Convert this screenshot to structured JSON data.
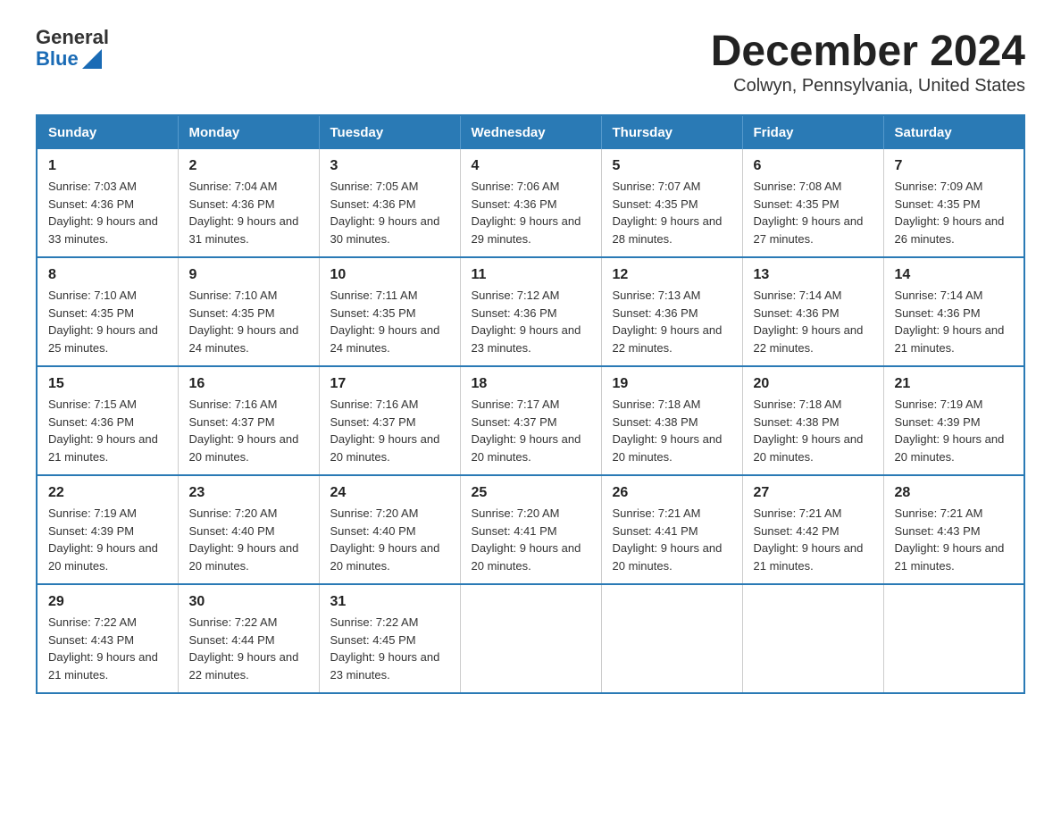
{
  "header": {
    "logo_general": "General",
    "logo_blue": "Blue",
    "title": "December 2024",
    "subtitle": "Colwyn, Pennsylvania, United States"
  },
  "weekdays": [
    "Sunday",
    "Monday",
    "Tuesday",
    "Wednesday",
    "Thursday",
    "Friday",
    "Saturday"
  ],
  "weeks": [
    [
      {
        "day": "1",
        "sunrise": "7:03 AM",
        "sunset": "4:36 PM",
        "daylight": "9 hours and 33 minutes."
      },
      {
        "day": "2",
        "sunrise": "7:04 AM",
        "sunset": "4:36 PM",
        "daylight": "9 hours and 31 minutes."
      },
      {
        "day": "3",
        "sunrise": "7:05 AM",
        "sunset": "4:36 PM",
        "daylight": "9 hours and 30 minutes."
      },
      {
        "day": "4",
        "sunrise": "7:06 AM",
        "sunset": "4:36 PM",
        "daylight": "9 hours and 29 minutes."
      },
      {
        "day": "5",
        "sunrise": "7:07 AM",
        "sunset": "4:35 PM",
        "daylight": "9 hours and 28 minutes."
      },
      {
        "day": "6",
        "sunrise": "7:08 AM",
        "sunset": "4:35 PM",
        "daylight": "9 hours and 27 minutes."
      },
      {
        "day": "7",
        "sunrise": "7:09 AM",
        "sunset": "4:35 PM",
        "daylight": "9 hours and 26 minutes."
      }
    ],
    [
      {
        "day": "8",
        "sunrise": "7:10 AM",
        "sunset": "4:35 PM",
        "daylight": "9 hours and 25 minutes."
      },
      {
        "day": "9",
        "sunrise": "7:10 AM",
        "sunset": "4:35 PM",
        "daylight": "9 hours and 24 minutes."
      },
      {
        "day": "10",
        "sunrise": "7:11 AM",
        "sunset": "4:35 PM",
        "daylight": "9 hours and 24 minutes."
      },
      {
        "day": "11",
        "sunrise": "7:12 AM",
        "sunset": "4:36 PM",
        "daylight": "9 hours and 23 minutes."
      },
      {
        "day": "12",
        "sunrise": "7:13 AM",
        "sunset": "4:36 PM",
        "daylight": "9 hours and 22 minutes."
      },
      {
        "day": "13",
        "sunrise": "7:14 AM",
        "sunset": "4:36 PM",
        "daylight": "9 hours and 22 minutes."
      },
      {
        "day": "14",
        "sunrise": "7:14 AM",
        "sunset": "4:36 PM",
        "daylight": "9 hours and 21 minutes."
      }
    ],
    [
      {
        "day": "15",
        "sunrise": "7:15 AM",
        "sunset": "4:36 PM",
        "daylight": "9 hours and 21 minutes."
      },
      {
        "day": "16",
        "sunrise": "7:16 AM",
        "sunset": "4:37 PM",
        "daylight": "9 hours and 20 minutes."
      },
      {
        "day": "17",
        "sunrise": "7:16 AM",
        "sunset": "4:37 PM",
        "daylight": "9 hours and 20 minutes."
      },
      {
        "day": "18",
        "sunrise": "7:17 AM",
        "sunset": "4:37 PM",
        "daylight": "9 hours and 20 minutes."
      },
      {
        "day": "19",
        "sunrise": "7:18 AM",
        "sunset": "4:38 PM",
        "daylight": "9 hours and 20 minutes."
      },
      {
        "day": "20",
        "sunrise": "7:18 AM",
        "sunset": "4:38 PM",
        "daylight": "9 hours and 20 minutes."
      },
      {
        "day": "21",
        "sunrise": "7:19 AM",
        "sunset": "4:39 PM",
        "daylight": "9 hours and 20 minutes."
      }
    ],
    [
      {
        "day": "22",
        "sunrise": "7:19 AM",
        "sunset": "4:39 PM",
        "daylight": "9 hours and 20 minutes."
      },
      {
        "day": "23",
        "sunrise": "7:20 AM",
        "sunset": "4:40 PM",
        "daylight": "9 hours and 20 minutes."
      },
      {
        "day": "24",
        "sunrise": "7:20 AM",
        "sunset": "4:40 PM",
        "daylight": "9 hours and 20 minutes."
      },
      {
        "day": "25",
        "sunrise": "7:20 AM",
        "sunset": "4:41 PM",
        "daylight": "9 hours and 20 minutes."
      },
      {
        "day": "26",
        "sunrise": "7:21 AM",
        "sunset": "4:41 PM",
        "daylight": "9 hours and 20 minutes."
      },
      {
        "day": "27",
        "sunrise": "7:21 AM",
        "sunset": "4:42 PM",
        "daylight": "9 hours and 21 minutes."
      },
      {
        "day": "28",
        "sunrise": "7:21 AM",
        "sunset": "4:43 PM",
        "daylight": "9 hours and 21 minutes."
      }
    ],
    [
      {
        "day": "29",
        "sunrise": "7:22 AM",
        "sunset": "4:43 PM",
        "daylight": "9 hours and 21 minutes."
      },
      {
        "day": "30",
        "sunrise": "7:22 AM",
        "sunset": "4:44 PM",
        "daylight": "9 hours and 22 minutes."
      },
      {
        "day": "31",
        "sunrise": "7:22 AM",
        "sunset": "4:45 PM",
        "daylight": "9 hours and 23 minutes."
      },
      null,
      null,
      null,
      null
    ]
  ]
}
